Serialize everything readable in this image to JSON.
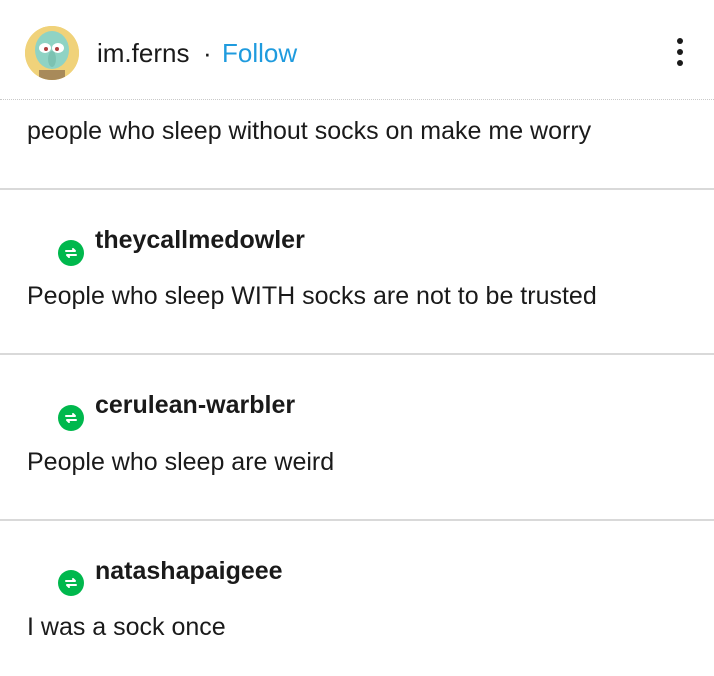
{
  "header": {
    "author": "im.ferns",
    "separator": "·",
    "follow_label": "Follow"
  },
  "original_post": {
    "text": "people who sleep without socks on make me worry"
  },
  "reblogs": [
    {
      "username": "theycallmedowler",
      "text": "People who sleep WITH socks are not to be trusted"
    },
    {
      "username": "cerulean-warbler",
      "text": "People who sleep are weird"
    },
    {
      "username": "natashapaigeee",
      "text": "I was a sock once"
    }
  ],
  "colors": {
    "follow": "#1f9bde",
    "reblog_icon": "#00b84d",
    "divider": "#d9d9d9"
  },
  "icons": {
    "menu": "vertical-ellipsis-icon",
    "reblog": "reblog-icon"
  }
}
